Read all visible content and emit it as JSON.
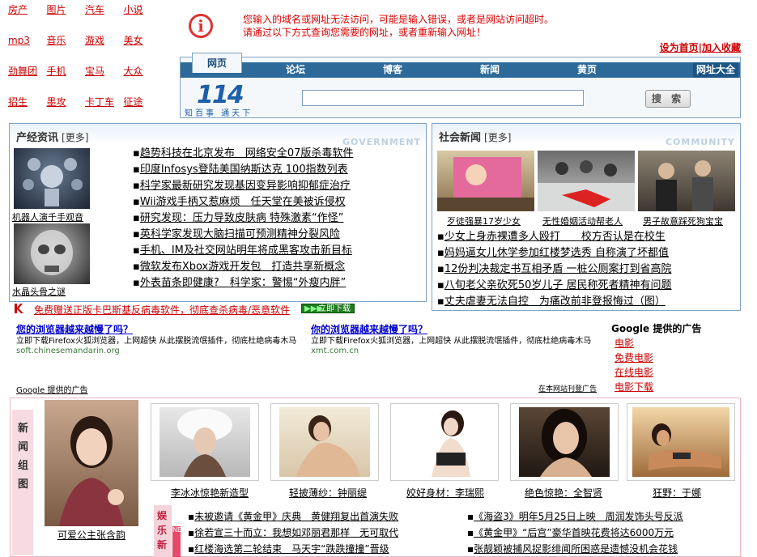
{
  "top_links": [
    [
      "房产",
      "图片",
      "汽车",
      "小说"
    ],
    [
      "mp3",
      "音乐",
      "游戏",
      "美女"
    ],
    [
      "劲舞团",
      "手机",
      "宝马",
      "大众"
    ],
    [
      "招生",
      "墨攻",
      "卡丁车",
      "征途"
    ]
  ],
  "error": {
    "line1": "您输入的域名或网址无法访问，可能是输入错误，或者是网站访问超时。",
    "line2": "请通过以下方式查询您需要的网址，或者重新输入网址！"
  },
  "header_links": {
    "homepage": "设为首页",
    "sep": "|",
    "favorite": "加入收藏"
  },
  "nav": {
    "tabs": [
      "网页",
      "论坛",
      "博客",
      "新闻",
      "黄页"
    ],
    "all": "网址大全"
  },
  "logo": {
    "number": "114",
    "sub": "知百事 通天下"
  },
  "search": {
    "button": "搜 索",
    "value": ""
  },
  "left_panel": {
    "title": "产经资讯",
    "more": "[更多]",
    "en": "GOVERNMENT",
    "captions": [
      "机器人演千手观音",
      "水晶头骨之谜"
    ],
    "news": [
      "趋势科技在北京发布　网络安全07版杀毒软件",
      "印度Infosys登陆美国纳斯达克 100指数列表",
      "科学家最新研究发现基因变异影响抑郁症治疗",
      "Wii游戏手柄又惹麻烦　任天堂在美被诉侵权",
      "研究发现：压力导致皮肤病 特殊激素“作怪”",
      "英科学家发现大脑扫描可预测精神分裂风险",
      "手机、IM及社交网站明年将成黑客攻击新目标",
      "微软发布Xbox游戏开发包　打造共享新概念",
      "外表苗条即健康?　科学家：警惕“外瘦内胖”"
    ]
  },
  "right_panel": {
    "title": "社会新闻",
    "more": "[更多]",
    "en": "COMMUNITY",
    "captions": [
      "歹徒强暴17岁少女",
      "无性婚姻活动帮老人",
      "男子故意踩死狗宝宝"
    ],
    "news": [
      "少女上身赤裸遭多人殴打　　校方否认是在校生",
      "妈妈逼女儿休学参加红楼梦选秀 自称演了坏都值",
      "12份判决裁定书互相矛盾 一桩公厕案打到省高院",
      "八旬老父亲砍死50岁儿子 居民称死者精神有问题",
      "丈夫虐妻无法自控　为痛改前非登报悔过（图）"
    ]
  },
  "promo": {
    "text": "免费赠送正版卡巴斯基反病毒软件，彻底查杀病毒/恶意软件",
    "download": "立即下载"
  },
  "ads": [
    {
      "title": "您的浏览器越来越慢了吗？",
      "desc": "立即下载Firefox火狐浏览器，上网超快 从此摆脱流氓插件，彻底杜绝病毒木马",
      "url": "soft.chinesemandarin.org"
    },
    {
      "title": "你的浏览器越来越慢了吗？",
      "desc": "立即下载Firefox火狐浏览器，上网超快 从此摆脱流氓插件，彻底杜绝病毒木马",
      "url": "xmt.com.cn"
    }
  ],
  "google_ads": {
    "title": "Google 提供的广告",
    "links": [
      "电影",
      "免费电影",
      "在线电影",
      "电影下载"
    ]
  },
  "ad_footer": {
    "left": "Google 提供的广告",
    "right": "在本网站刊登广告"
  },
  "bottom": {
    "vtab": "新闻组图",
    "main_caption": "可爱公主张含韵",
    "photo_captions": [
      "李冰冰惊艳新造型",
      "轻披薄纱：钟丽缇",
      "姣好身材：李瑞熙",
      "绝色惊艳：全智贤",
      "狂野：于娜"
    ],
    "ent_tab": "娱乐新",
    "ent_sub": "NEWS",
    "ent_left": [
      "未被邀请《黄金甲》庆典　黄健翔复出首演失败",
      "徐若宣三十而立：我想如邓丽君那样　无可取代",
      "红楼海选第二轮结束　马天宇“跌跌撞撞”晋级"
    ],
    "ent_right": [
      "《海盗3》明年5月25日上映　周润发饰头号反派",
      "《黄金甲》“后宫”豪华首映花费将达6000万元",
      "张靓颖被捕风捉影绯闻所困惑是遗憾没机会花钱"
    ]
  },
  "colors": {
    "accent_red": "#cc0000",
    "nav_blue": "#2d6a9a",
    "ad_blue": "#0000cc"
  }
}
